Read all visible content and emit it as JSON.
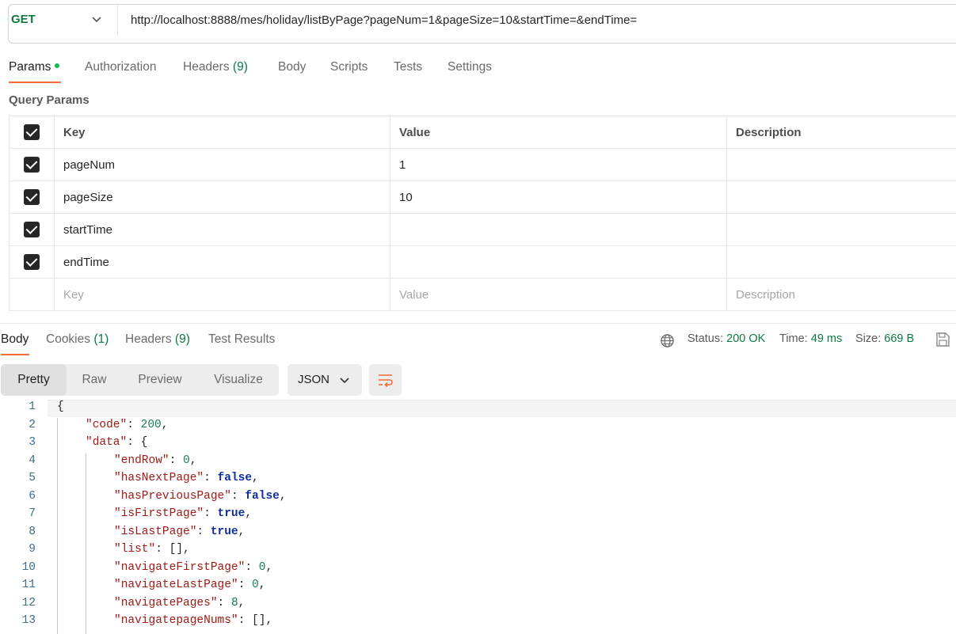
{
  "request": {
    "method": "GET",
    "url": "http://localhost:8888/mes/holiday/listByPage?pageNum=1&pageSize=10&startTime=&endTime="
  },
  "request_tabs": [
    {
      "label": "Params",
      "count": "",
      "active": true
    },
    {
      "label": "Authorization",
      "count": ""
    },
    {
      "label": "Headers",
      "count": "(9)"
    },
    {
      "label": "Body",
      "count": ""
    },
    {
      "label": "Scripts",
      "count": ""
    },
    {
      "label": "Tests",
      "count": ""
    },
    {
      "label": "Settings",
      "count": ""
    }
  ],
  "query_params": {
    "title": "Query Params",
    "headers": {
      "key": "Key",
      "value": "Value",
      "description": "Description"
    },
    "rows": [
      {
        "key": "pageNum",
        "value": "1",
        "description": ""
      },
      {
        "key": "pageSize",
        "value": "10",
        "description": ""
      },
      {
        "key": "startTime",
        "value": "",
        "description": ""
      },
      {
        "key": "endTime",
        "value": "",
        "description": ""
      }
    ],
    "placeholders": {
      "key": "Key",
      "value": "Value",
      "description": "Description"
    }
  },
  "response_tabs": [
    {
      "label": "Body",
      "count": "",
      "active": true
    },
    {
      "label": "Cookies",
      "count": "(1)"
    },
    {
      "label": "Headers",
      "count": "(9)"
    },
    {
      "label": "Test Results",
      "count": ""
    }
  ],
  "response_status": {
    "status_label": "Status:",
    "status_value": "200 OK",
    "time_label": "Time:",
    "time_value": "49 ms",
    "size_label": "Size:",
    "size_value": "669 B"
  },
  "view_modes": [
    "Pretty",
    "Raw",
    "Preview",
    "Visualize"
  ],
  "format": "JSON",
  "colors": {
    "accent": "#f26b3a",
    "success": "#0b7a3f",
    "dot": "#0cbb52"
  },
  "code_lines": [
    {
      "n": "1",
      "indent": 0,
      "parts": [
        {
          "t": "{",
          "c": "p"
        }
      ]
    },
    {
      "n": "2",
      "indent": 1,
      "parts": [
        {
          "t": "\"code\"",
          "c": "k"
        },
        {
          "t": ": ",
          "c": "p"
        },
        {
          "t": "200",
          "c": "n"
        },
        {
          "t": ",",
          "c": "p"
        }
      ]
    },
    {
      "n": "3",
      "indent": 1,
      "parts": [
        {
          "t": "\"data\"",
          "c": "k"
        },
        {
          "t": ": {",
          "c": "p"
        }
      ]
    },
    {
      "n": "4",
      "indent": 2,
      "parts": [
        {
          "t": "\"endRow\"",
          "c": "k"
        },
        {
          "t": ": ",
          "c": "p"
        },
        {
          "t": "0",
          "c": "n"
        },
        {
          "t": ",",
          "c": "p"
        }
      ]
    },
    {
      "n": "5",
      "indent": 2,
      "parts": [
        {
          "t": "\"hasNextPage\"",
          "c": "k"
        },
        {
          "t": ": ",
          "c": "p"
        },
        {
          "t": "false",
          "c": "b"
        },
        {
          "t": ",",
          "c": "p"
        }
      ]
    },
    {
      "n": "6",
      "indent": 2,
      "parts": [
        {
          "t": "\"hasPreviousPage\"",
          "c": "k"
        },
        {
          "t": ": ",
          "c": "p"
        },
        {
          "t": "false",
          "c": "b"
        },
        {
          "t": ",",
          "c": "p"
        }
      ]
    },
    {
      "n": "7",
      "indent": 2,
      "parts": [
        {
          "t": "\"isFirstPage\"",
          "c": "k"
        },
        {
          "t": ": ",
          "c": "p"
        },
        {
          "t": "true",
          "c": "b"
        },
        {
          "t": ",",
          "c": "p"
        }
      ]
    },
    {
      "n": "8",
      "indent": 2,
      "parts": [
        {
          "t": "\"isLastPage\"",
          "c": "k"
        },
        {
          "t": ": ",
          "c": "p"
        },
        {
          "t": "true",
          "c": "b"
        },
        {
          "t": ",",
          "c": "p"
        }
      ]
    },
    {
      "n": "9",
      "indent": 2,
      "parts": [
        {
          "t": "\"list\"",
          "c": "k"
        },
        {
          "t": ": [],",
          "c": "p"
        }
      ]
    },
    {
      "n": "10",
      "indent": 2,
      "parts": [
        {
          "t": "\"navigateFirstPage\"",
          "c": "k"
        },
        {
          "t": ": ",
          "c": "p"
        },
        {
          "t": "0",
          "c": "n"
        },
        {
          "t": ",",
          "c": "p"
        }
      ]
    },
    {
      "n": "11",
      "indent": 2,
      "parts": [
        {
          "t": "\"navigateLastPage\"",
          "c": "k"
        },
        {
          "t": ": ",
          "c": "p"
        },
        {
          "t": "0",
          "c": "n"
        },
        {
          "t": ",",
          "c": "p"
        }
      ]
    },
    {
      "n": "12",
      "indent": 2,
      "parts": [
        {
          "t": "\"navigatePages\"",
          "c": "k"
        },
        {
          "t": ": ",
          "c": "p"
        },
        {
          "t": "8",
          "c": "n"
        },
        {
          "t": ",",
          "c": "p"
        }
      ]
    },
    {
      "n": "13",
      "indent": 2,
      "parts": [
        {
          "t": "\"navigatepageNums\"",
          "c": "k"
        },
        {
          "t": ": [],",
          "c": "p"
        }
      ]
    }
  ]
}
